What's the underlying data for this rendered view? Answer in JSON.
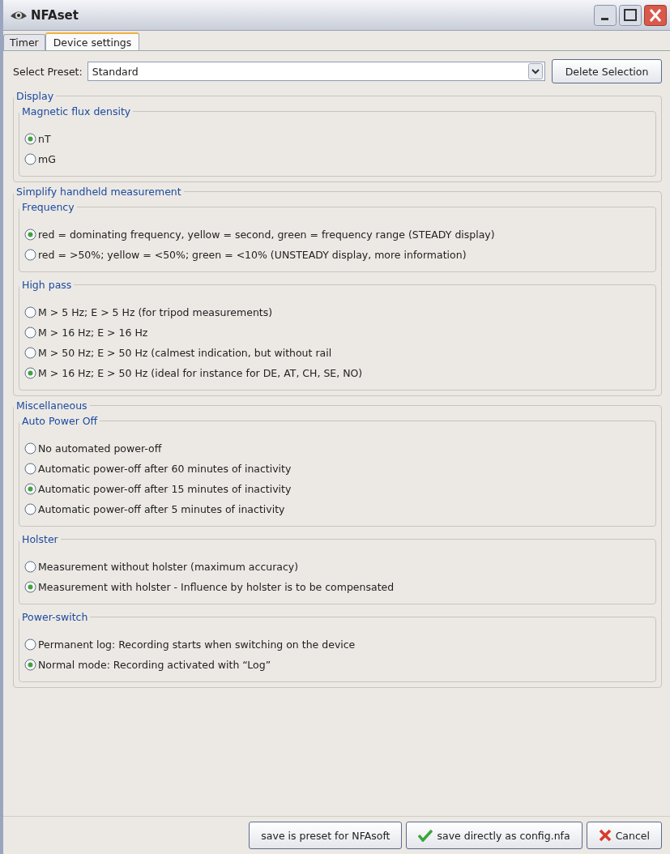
{
  "window": {
    "title": "NFAset"
  },
  "tabs": [
    {
      "label": "Timer",
      "selected": false
    },
    {
      "label": "Device settings",
      "selected": true
    }
  ],
  "preset": {
    "label": "Select Preset:",
    "value": "Standard",
    "delete_button": "Delete Selection"
  },
  "sections": [
    {
      "title": "Display",
      "groups": [
        {
          "title": "Magnetic flux density",
          "options": [
            {
              "label": "nT",
              "selected": true
            },
            {
              "label": "mG",
              "selected": false
            }
          ]
        }
      ]
    },
    {
      "title": "Simplify handheld measurement",
      "groups": [
        {
          "title": "Frequency",
          "options": [
            {
              "label": "red = dominating frequency, yellow = second, green = frequency range (STEADY display)",
              "selected": true
            },
            {
              "label": "red = >50%; yellow = <50%; green = <10% (UNSTEADY display, more information)",
              "selected": false
            }
          ]
        },
        {
          "title": "High pass",
          "options": [
            {
              "label": "M > 5 Hz; E > 5 Hz (for tripod measurements)",
              "selected": false
            },
            {
              "label": "M > 16 Hz; E > 16 Hz",
              "selected": false
            },
            {
              "label": "M > 50 Hz; E > 50 Hz (calmest indication, but without rail",
              "selected": false
            },
            {
              "label": "M > 16 Hz; E > 50 Hz (ideal for instance for DE, AT, CH, SE, NO)",
              "selected": true
            }
          ]
        }
      ]
    },
    {
      "title": "Miscellaneous",
      "groups": [
        {
          "title": "Auto Power Off",
          "options": [
            {
              "label": "No automated power-off",
              "selected": false
            },
            {
              "label": "Automatic power-off after 60 minutes of inactivity",
              "selected": false
            },
            {
              "label": "Automatic power-off after 15 minutes of inactivity",
              "selected": true
            },
            {
              "label": "Automatic power-off after 5 minutes of inactivity",
              "selected": false
            }
          ]
        },
        {
          "title": "Holster",
          "options": [
            {
              "label": "Measurement without holster (maximum accuracy)",
              "selected": false
            },
            {
              "label": "Measurement with holster - Influence by holster is to be compensated",
              "selected": true
            }
          ]
        },
        {
          "title": "Power-switch",
          "options": [
            {
              "label": "Permanent log: Recording starts when switching on the device",
              "selected": false
            },
            {
              "label": "Normal mode: Recording activated with “Log”",
              "selected": true
            }
          ]
        }
      ]
    }
  ],
  "buttons": [
    {
      "label": "save is preset for NFAsoft",
      "kind": "plain"
    },
    {
      "label": "save directly as config.nfa",
      "kind": "check"
    },
    {
      "label": "Cancel",
      "kind": "cross"
    }
  ]
}
